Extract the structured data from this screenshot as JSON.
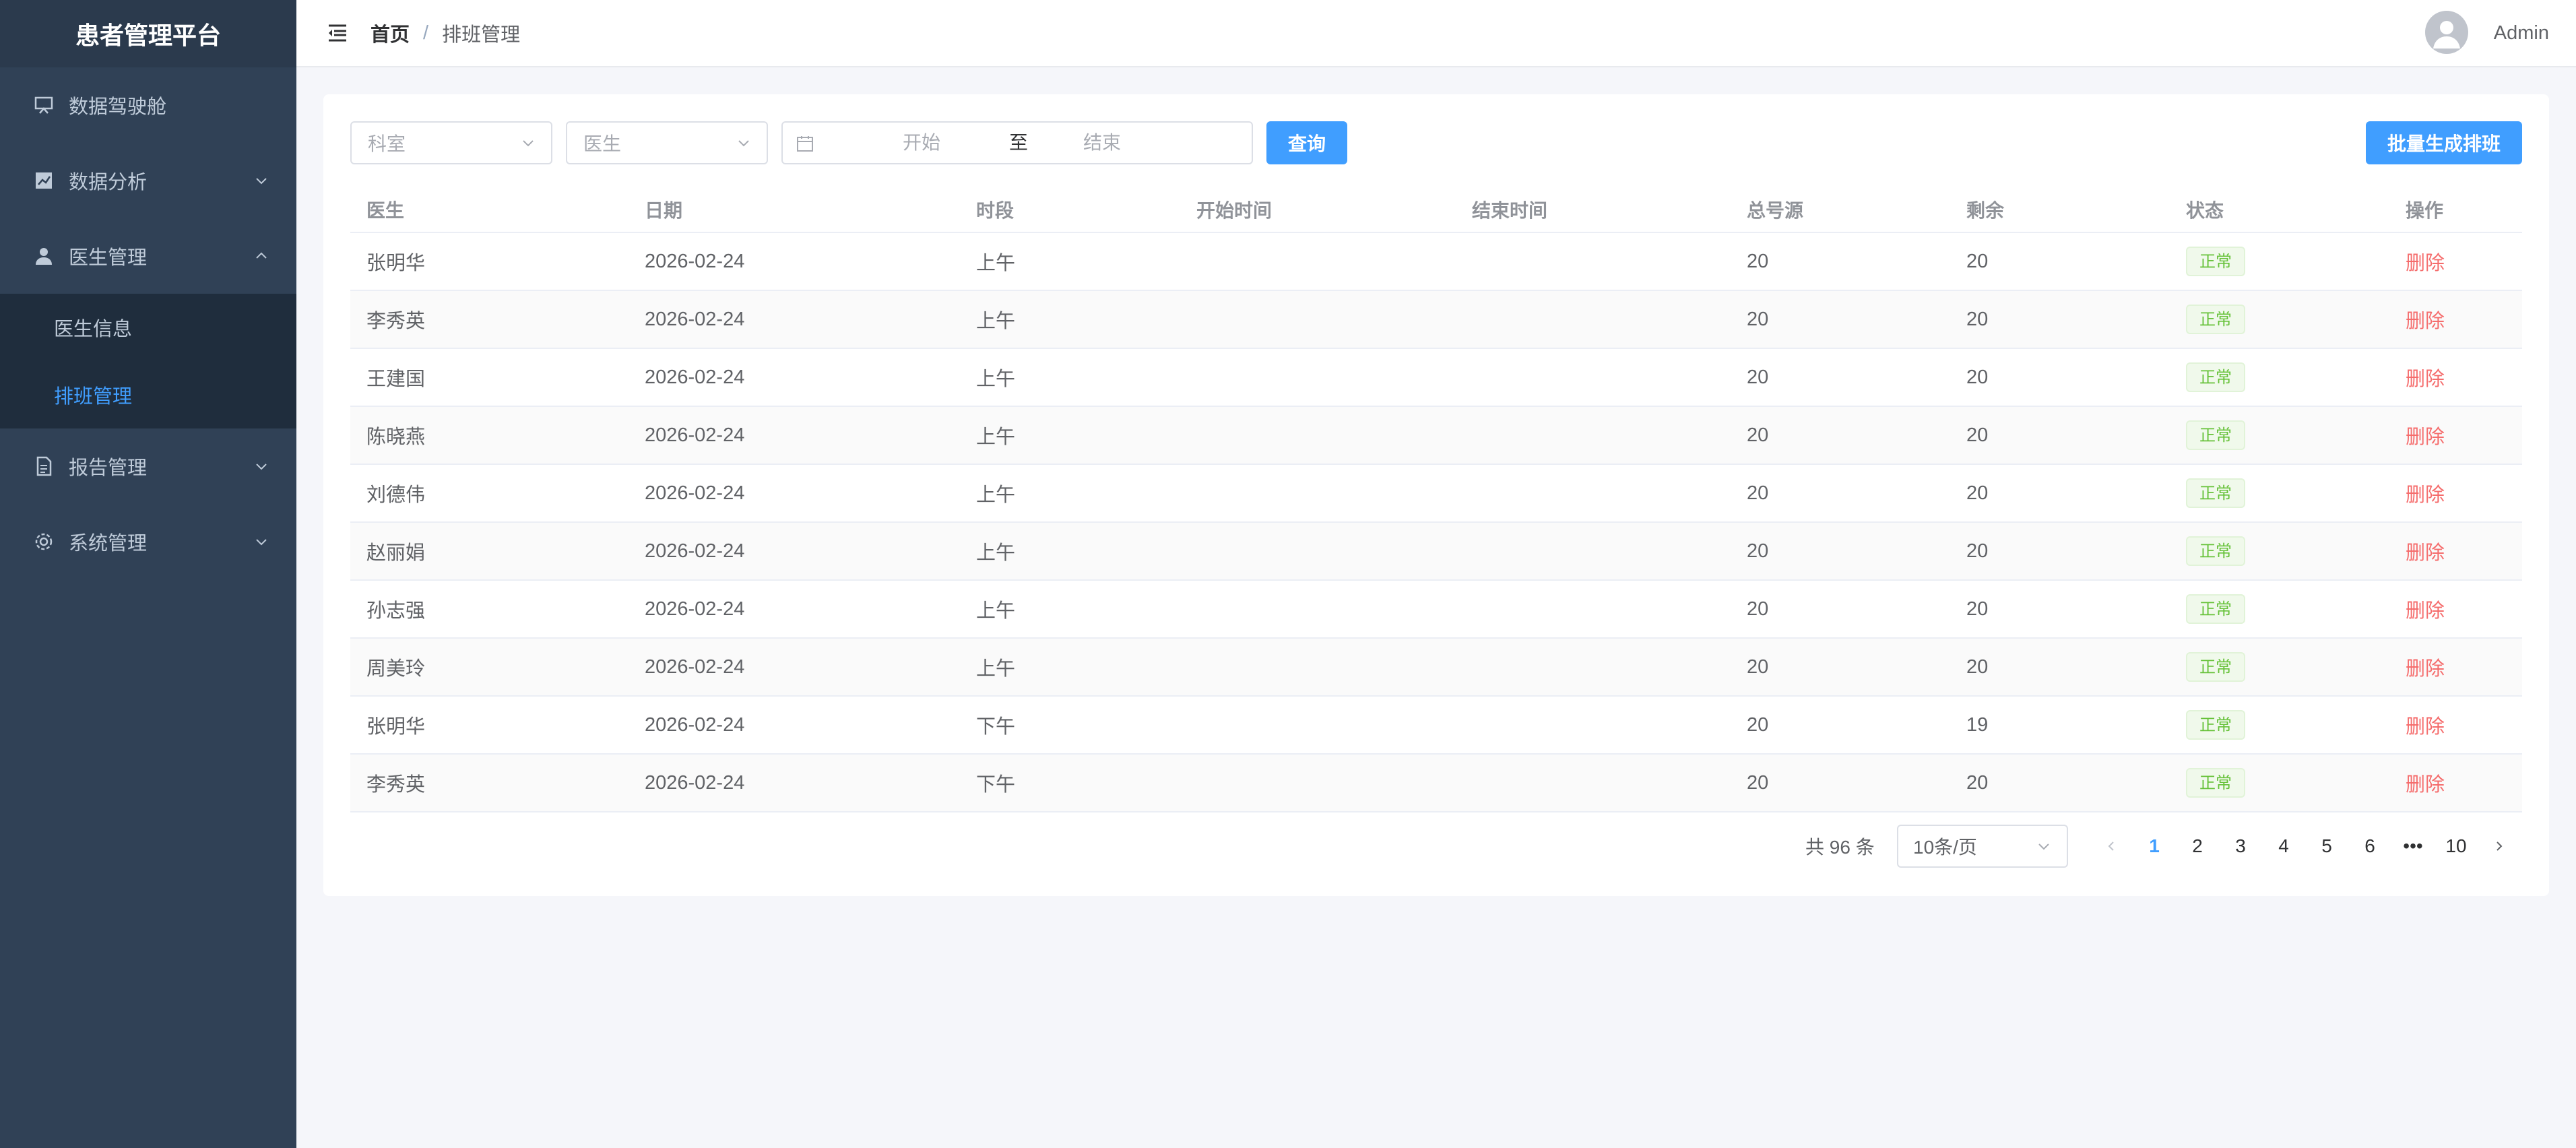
{
  "sidebar": {
    "title": "患者管理平台",
    "items": [
      {
        "label": "数据驾驶舱",
        "icon": "monitor-icon"
      },
      {
        "label": "数据分析",
        "icon": "chart-icon"
      },
      {
        "label": "医生管理",
        "icon": "user-icon"
      },
      {
        "label": "报告管理",
        "icon": "document-icon"
      },
      {
        "label": "系统管理",
        "icon": "gear-icon"
      }
    ],
    "sub_items": [
      {
        "label": "医生信息"
      },
      {
        "label": "排班管理"
      }
    ]
  },
  "header": {
    "breadcrumb_home": "首页",
    "breadcrumb_sep": "/",
    "breadcrumb_current": "排班管理",
    "user": "Admin"
  },
  "filters": {
    "department_placeholder": "科室",
    "doctor_placeholder": "医生",
    "start_placeholder": "开始",
    "range_sep": "至",
    "end_placeholder": "结束",
    "query_label": "查询",
    "batch_label": "批量生成排班"
  },
  "table": {
    "columns": [
      "医生",
      "日期",
      "时段",
      "开始时间",
      "结束时间",
      "总号源",
      "剩余",
      "状态",
      "操作"
    ],
    "rows": [
      {
        "doctor": "张明华",
        "date": "2026-02-24",
        "period": "上午",
        "start": "",
        "end": "",
        "total": "20",
        "remain": "20",
        "status": "正常",
        "action": "删除"
      },
      {
        "doctor": "李秀英",
        "date": "2026-02-24",
        "period": "上午",
        "start": "",
        "end": "",
        "total": "20",
        "remain": "20",
        "status": "正常",
        "action": "删除"
      },
      {
        "doctor": "王建国",
        "date": "2026-02-24",
        "period": "上午",
        "start": "",
        "end": "",
        "total": "20",
        "remain": "20",
        "status": "正常",
        "action": "删除"
      },
      {
        "doctor": "陈晓燕",
        "date": "2026-02-24",
        "period": "上午",
        "start": "",
        "end": "",
        "total": "20",
        "remain": "20",
        "status": "正常",
        "action": "删除"
      },
      {
        "doctor": "刘德伟",
        "date": "2026-02-24",
        "period": "上午",
        "start": "",
        "end": "",
        "total": "20",
        "remain": "20",
        "status": "正常",
        "action": "删除"
      },
      {
        "doctor": "赵丽娟",
        "date": "2026-02-24",
        "period": "上午",
        "start": "",
        "end": "",
        "total": "20",
        "remain": "20",
        "status": "正常",
        "action": "删除"
      },
      {
        "doctor": "孙志强",
        "date": "2026-02-24",
        "period": "上午",
        "start": "",
        "end": "",
        "total": "20",
        "remain": "20",
        "status": "正常",
        "action": "删除"
      },
      {
        "doctor": "周美玲",
        "date": "2026-02-24",
        "period": "上午",
        "start": "",
        "end": "",
        "total": "20",
        "remain": "20",
        "status": "正常",
        "action": "删除"
      },
      {
        "doctor": "张明华",
        "date": "2026-02-24",
        "period": "下午",
        "start": "",
        "end": "",
        "total": "20",
        "remain": "19",
        "status": "正常",
        "action": "删除"
      },
      {
        "doctor": "李秀英",
        "date": "2026-02-24",
        "period": "下午",
        "start": "",
        "end": "",
        "total": "20",
        "remain": "20",
        "status": "正常",
        "action": "删除"
      }
    ]
  },
  "pagination": {
    "total_text": "共 96 条",
    "page_size": "10条/页",
    "pages": [
      "1",
      "2",
      "3",
      "4",
      "5",
      "6"
    ],
    "ellipsis": "•••",
    "last_page": "10",
    "current": "1"
  },
  "colors": {
    "primary": "#409eff",
    "sidebar_bg": "#304156",
    "success": "#67c23a",
    "danger": "#f56c6c"
  }
}
